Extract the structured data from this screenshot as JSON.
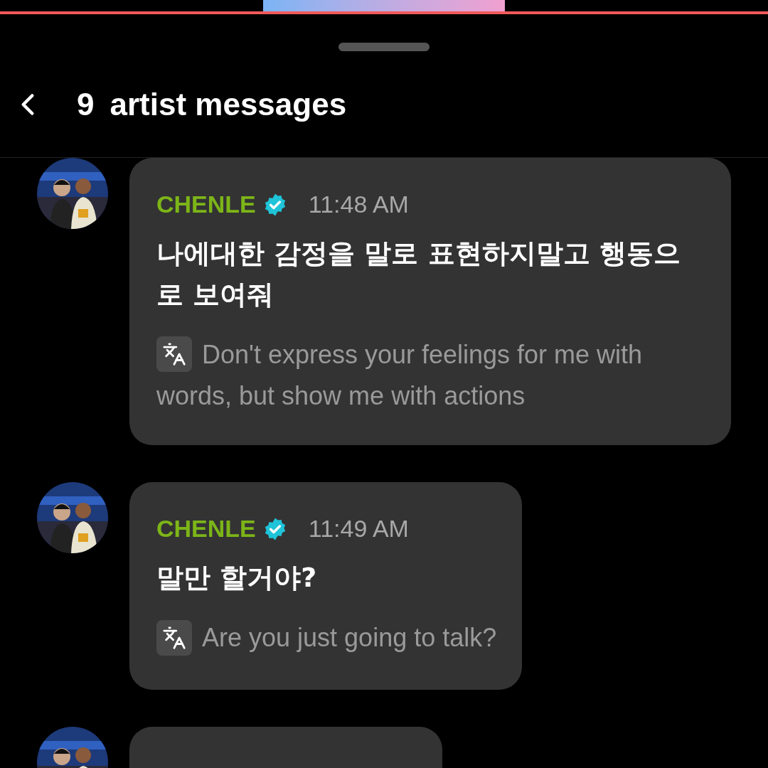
{
  "header": {
    "count": "9",
    "title": "artist messages"
  },
  "messages": [
    {
      "sender": "CHENLE",
      "verified": true,
      "time": "11:48 AM",
      "text": "나에대한 감정을 말로 표현하지말고 행동으로 보여줘",
      "translation": "Don't express your feelings for me with words, but show me with actions"
    },
    {
      "sender": "CHENLE",
      "verified": true,
      "time": "11:49 AM",
      "text": "말만 할거야?",
      "translation": "Are you just going to talk?"
    }
  ]
}
